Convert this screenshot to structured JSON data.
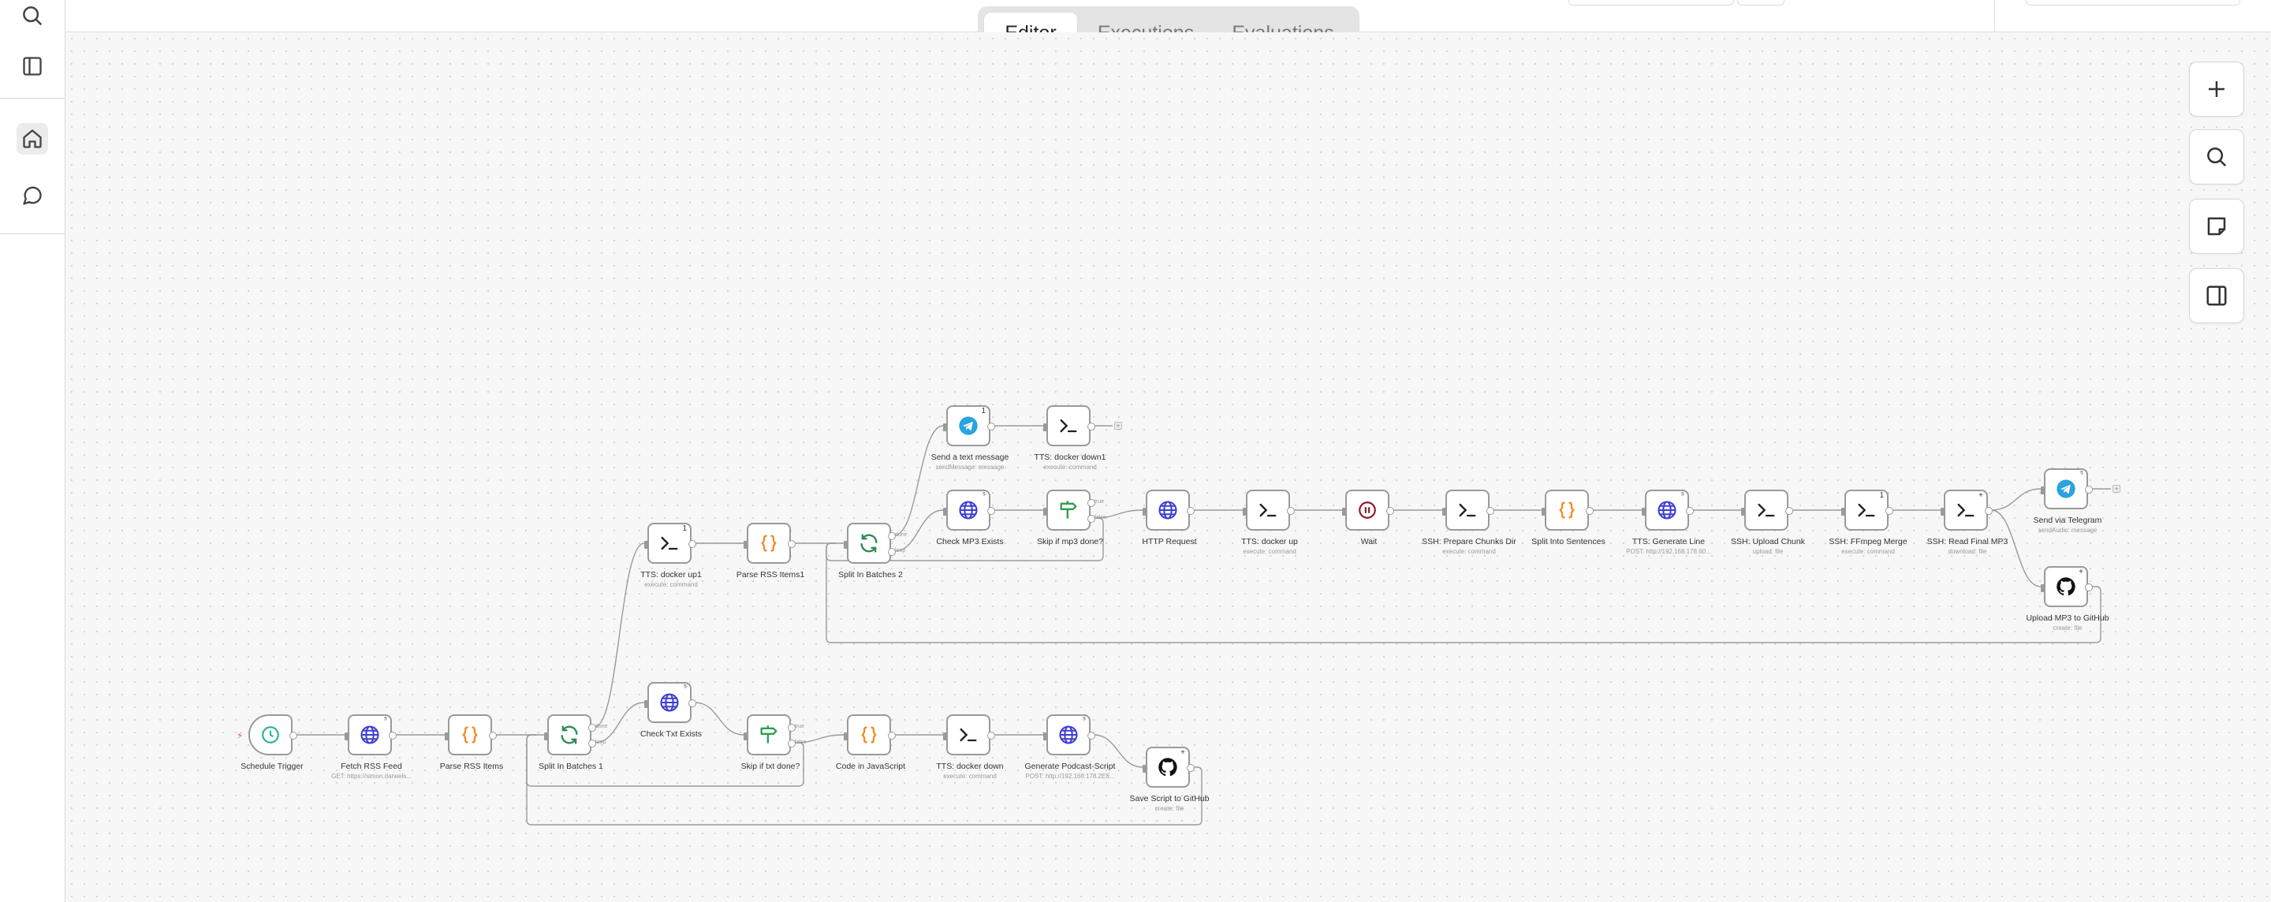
{
  "sidebar": {
    "icons": [
      "search-icon",
      "panel-toggle-icon",
      "home-icon",
      "chat-icon"
    ]
  },
  "tabs": [
    {
      "label": "Editor",
      "active": true
    },
    {
      "label": "Executions",
      "active": false
    },
    {
      "label": "Evaluations",
      "active": false
    }
  ],
  "canvas_controls": [
    "plus-icon",
    "search-icon",
    "sticky-note-icon",
    "panel-right-icon"
  ],
  "nodes": {
    "schedule_trigger": {
      "label": "Schedule Trigger",
      "sub": ""
    },
    "fetch_rss": {
      "label": "Fetch RSS Feed",
      "sub": "GET: https://simon.darwels..."
    },
    "parse_rss": {
      "label": "Parse RSS Items",
      "sub": ""
    },
    "split1": {
      "label": "Split In Batches 1",
      "sub": ""
    },
    "check_txt": {
      "label": "Check Txt Exists",
      "sub": ""
    },
    "skip_txt": {
      "label": "Skip if txt done?",
      "sub": ""
    },
    "code_js": {
      "label": "Code in JavaScript",
      "sub": ""
    },
    "tts_down": {
      "label": "TTS: docker down",
      "sub": "execute: command"
    },
    "gen_podcast": {
      "label": "Generate Podcast-Script",
      "sub": "POST: http://192.168.178.2E8..."
    },
    "save_script": {
      "label": "Save Script to GitHub",
      "sub": "create: file"
    },
    "tts_up1": {
      "label": "TTS: docker up1",
      "sub": "execute: command"
    },
    "parse_rss1": {
      "label": "Parse RSS Items1",
      "sub": ""
    },
    "split2": {
      "label": "Split In Batches 2",
      "sub": ""
    },
    "send_text": {
      "label": "Send a text message",
      "sub": "sendMessage: message"
    },
    "tts_down1": {
      "label": "TTS: docker down1",
      "sub": "execute: command"
    },
    "check_mp3": {
      "label": "Check MP3 Exists",
      "sub": ""
    },
    "skip_mp3": {
      "label": "Skip if mp3 done?",
      "sub": ""
    },
    "http_req": {
      "label": "HTTP Request",
      "sub": ""
    },
    "tts_up": {
      "label": "TTS: docker up",
      "sub": "execute: command"
    },
    "wait": {
      "label": "Wait",
      "sub": ""
    },
    "ssh_prep": {
      "label": "SSH: Prepare Chunks Dir",
      "sub": "execute: command"
    },
    "split_sent": {
      "label": "Split Into Sentences",
      "sub": ""
    },
    "tts_gen": {
      "label": "TTS: Generate Line",
      "sub": "POST: http://192.168.178.60..."
    },
    "ssh_upload": {
      "label": "SSH: Upload Chunk",
      "sub": "upload: file"
    },
    "ssh_ffmpeg": {
      "label": "SSH: FFmpeg Merge",
      "sub": "execute: command"
    },
    "ssh_read": {
      "label": "SSH: Read Final MP3",
      "sub": "download: file"
    },
    "send_tg": {
      "label": "Send via Telegram",
      "sub": "sendAudio: message"
    },
    "upload_gh": {
      "label": "Upload MP3 to GitHub",
      "sub": "create: file"
    }
  },
  "badges": {
    "one": "1",
    "link": "⁵",
    "pin": "+"
  },
  "port_labels": {
    "done": "done",
    "loop": "loop",
    "true": "true",
    "false": "false"
  }
}
